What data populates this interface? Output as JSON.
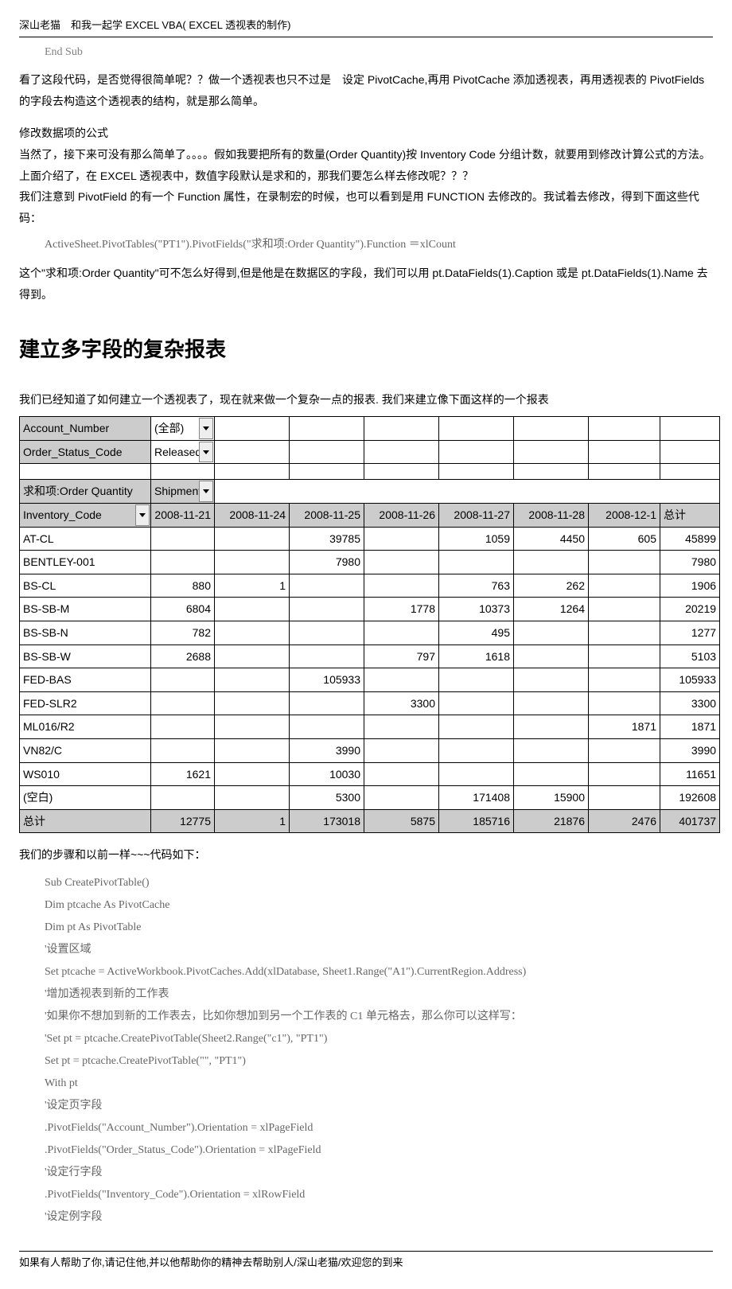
{
  "header": "深山老猫　和我一起学 EXCEL VBA( EXCEL 透视表的制作)",
  "code_top": "End Sub",
  "para1": "看了这段代码，是否觉得很简单呢？？做一个透视表也只不过是　设定 PivotCache,再用 PivotCache 添加透视表，再用透视表的 PivotFields 的字段去构造这个透视表的结构，就是那么简单。",
  "para2_title": "修改数据项的公式",
  "para2a": "当然了，接下来可没有那么简单了。。。。假如我要把所有的数量(Order Quantity)按 Inventory Code 分组计数，就要用到修改计算公式的方法。上面介绍了，在 EXCEL 透视表中，数值字段默认是求和的，那我们要怎么样去修改呢？？？",
  "para2b": "我们注意到 PivotField 的有一个 Function 属性，在录制宏的时候，也可以看到是用 FUNCTION 去修改的。我试着去修改，得到下面这些代码：",
  "code_mid": "ActiveSheet.PivotTables(\"PT1\").PivotFields(\"求和项:Order Quantity\").Function ＝xlCount",
  "para2c": "这个\"求和项:Order Quantity\"可不怎么好得到,但是他是在数据区的字段，我们可以用 pt.DataFields(1).Caption 或是 pt.DataFields(1).Name 去得到。",
  "h1": "建立多字段的复杂报表",
  "para3": "我们已经知道了如何建立一个透视表了，现在就来做一个复杂一点的报表. 我们来建立像下面这样的一个报表",
  "filters": {
    "r1c1": "Account_Number",
    "r1c2": "(全部)",
    "r2c1": "Order_Status_Code",
    "r2c2": "Released"
  },
  "pivot_hdr": {
    "a": "求和项:Order Quantity",
    "b": "Shipment",
    "row_label": "Inventory_Code",
    "cols": [
      "2008-11-21",
      "2008-11-24",
      "2008-11-25",
      "2008-11-26",
      "2008-11-27",
      "2008-11-28",
      "2008-12-1",
      "总计"
    ]
  },
  "rows": [
    {
      "n": "AT-CL",
      "v": [
        "",
        "",
        "39785",
        "",
        "1059",
        "4450",
        "605",
        "45899"
      ]
    },
    {
      "n": "BENTLEY-001",
      "v": [
        "",
        "",
        "7980",
        "",
        "",
        "",
        "",
        "7980"
      ]
    },
    {
      "n": "BS-CL",
      "v": [
        "880",
        "1",
        "",
        "",
        "763",
        "262",
        "",
        "1906"
      ]
    },
    {
      "n": "BS-SB-M",
      "v": [
        "6804",
        "",
        "",
        "1778",
        "10373",
        "1264",
        "",
        "20219"
      ]
    },
    {
      "n": "BS-SB-N",
      "v": [
        "782",
        "",
        "",
        "",
        "495",
        "",
        "",
        "1277"
      ]
    },
    {
      "n": "BS-SB-W",
      "v": [
        "2688",
        "",
        "",
        "797",
        "1618",
        "",
        "",
        "5103"
      ]
    },
    {
      "n": "FED-BAS",
      "v": [
        "",
        "",
        "105933",
        "",
        "",
        "",
        "",
        "105933"
      ]
    },
    {
      "n": "FED-SLR2",
      "v": [
        "",
        "",
        "",
        "3300",
        "",
        "",
        "",
        "3300"
      ]
    },
    {
      "n": "ML016/R2",
      "v": [
        "",
        "",
        "",
        "",
        "",
        "",
        "1871",
        "1871"
      ]
    },
    {
      "n": "VN82/C",
      "v": [
        "",
        "",
        "3990",
        "",
        "",
        "",
        "",
        "3990"
      ]
    },
    {
      "n": "WS010",
      "v": [
        "1621",
        "",
        "10030",
        "",
        "",
        "",
        "",
        "11651"
      ]
    },
    {
      "n": "(空白)",
      "v": [
        "",
        "",
        "5300",
        "",
        "171408",
        "15900",
        "",
        "192608"
      ]
    },
    {
      "n": "总计",
      "v": [
        "12775",
        "1",
        "173018",
        "5875",
        "185716",
        "21876",
        "2476",
        "401737"
      ]
    }
  ],
  "para4": "我们的步骤和以前一样~~~代码如下：",
  "code": [
    "Sub CreatePivotTable()",
    "Dim ptcache As PivotCache",
    "Dim pt As PivotTable",
    "'设置区域",
    "Set ptcache = ActiveWorkbook.PivotCaches.Add(xlDatabase, Sheet1.Range(\"A1\").CurrentRegion.Address)",
    "'增加透视表到新的工作表",
    "'如果你不想加到新的工作表去，比如你想加到另一个工作表的 C1 单元格去，那么你可以这样写：",
    "'Set pt = ptcache.CreatePivotTable(Sheet2.Range(\"c1\"), \"PT1\")",
    "Set pt = ptcache.CreatePivotTable(\"\", \"PT1\")",
    "With pt",
    "'设定页字段",
    ".PivotFields(\"Account_Number\").Orientation = xlPageField",
    ".PivotFields(\"Order_Status_Code\").Orientation = xlPageField",
    "'设定行字段",
    ".PivotFields(\"Inventory_Code\").Orientation = xlRowField",
    "'设定例字段"
  ],
  "footer": "如果有人帮助了你,请记住他,并以他帮助你的精神去帮助别人/深山老猫/欢迎您的到来"
}
